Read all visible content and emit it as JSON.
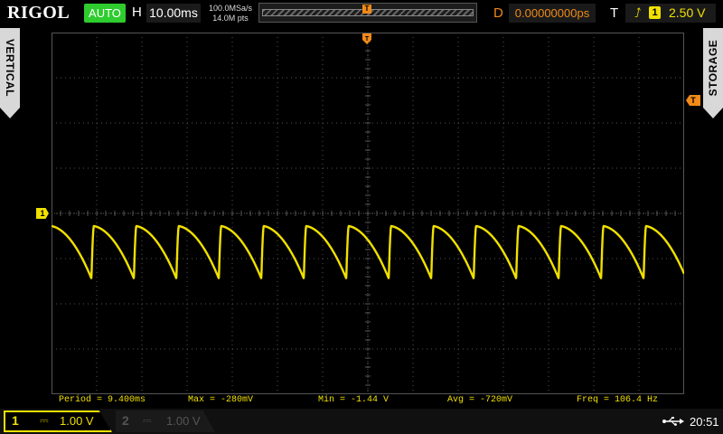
{
  "header": {
    "brand": "RIGOL",
    "run_mode": "AUTO",
    "h_label": "H",
    "timebase": "10.00ms",
    "sample_rate": "100.0MSa/s",
    "memory_depth": "14.0M pts",
    "delay_label": "D",
    "delay": "0.00000000ps",
    "trigger_label": "T",
    "trigger_source": "1",
    "trigger_level": "2.50 V",
    "trigger_marker": "T"
  },
  "side_tabs": {
    "left": "VERTICAL",
    "right": "STORAGE"
  },
  "markers": {
    "ch1": "1",
    "trig_level": "T"
  },
  "measurements": {
    "period": "Period = 9.400ms",
    "max": "Max = -280mV",
    "min": "Min = -1.44 V",
    "avg": "Avg = -720mV",
    "freq": "Freq = 106.4 Hz"
  },
  "channels": {
    "ch1": {
      "number": "1",
      "coupling": "⎓",
      "scale": "1.00 V"
    },
    "ch2": {
      "number": "2",
      "coupling": "⎓",
      "scale": "1.00 V"
    }
  },
  "status": {
    "usb_icon": "usb-icon",
    "time": "20:51"
  },
  "colors": {
    "ch1": "#f0e000",
    "trigger": "#f08a18",
    "auto_badge": "#2ecc2e",
    "grid": "#555555"
  },
  "chart_data": {
    "type": "line",
    "title": "",
    "xlabel": "",
    "ylabel": "",
    "x_unit": "ms",
    "y_unit": "V",
    "xlim": [
      -70,
      70
    ],
    "ylim": [
      -4,
      4
    ],
    "series": [
      {
        "period_ms": 9.4,
        "first_peak_ms": -60.6,
        "max_v": -0.28,
        "min_v": -1.44,
        "waveform": "sawtooth (sharp rise, curved decay)"
      }
    ]
  }
}
